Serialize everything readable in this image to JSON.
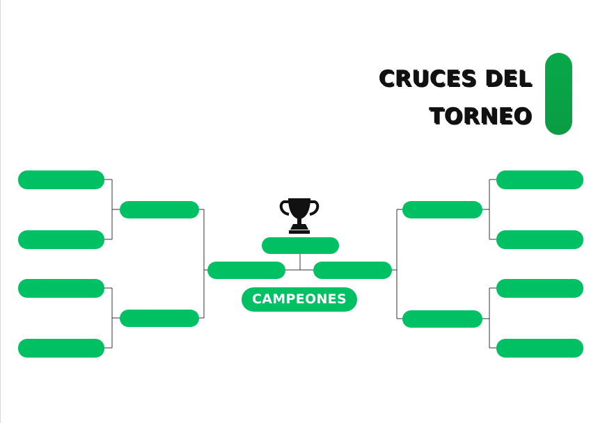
{
  "title": {
    "line1": "CRUCES DEL",
    "line2": "TORNEO"
  },
  "champion_label": "CAMPEONES",
  "icons": {
    "trophy": "trophy-icon"
  },
  "colors": {
    "slot_green": "#00C064",
    "title_bar_green": "#0A9F46",
    "connector": "#333333",
    "title_text": "#111111"
  }
}
